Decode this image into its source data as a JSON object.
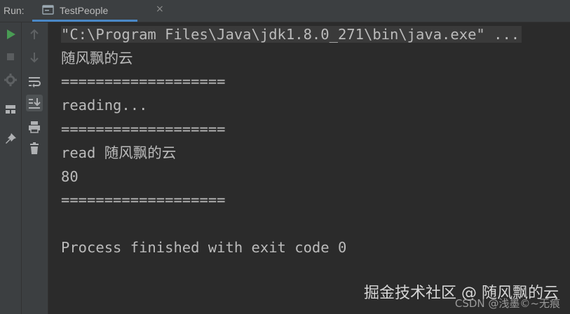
{
  "topbar": {
    "run_label": "Run:",
    "tab_label": "TestPeople",
    "tab_close": "×"
  },
  "icons": {
    "tab": "run-config-icon",
    "rerun": "run-icon",
    "stop": "stop-icon",
    "restore_layout": "restore-layout-icon",
    "layout": "layout-icon",
    "pin": "pin-icon",
    "up": "up-arrow-icon",
    "down": "down-arrow-icon",
    "soft_wrap": "soft-wrap-icon",
    "scroll_end": "scroll-to-end-icon",
    "print": "print-icon",
    "trash": "trash-icon"
  },
  "colors": {
    "run_green": "#499c54",
    "accent_blue": "#4a88c7",
    "console_bg": "#2b2b2b",
    "toolbar_bg": "#3c3f41",
    "text": "#bbbbbb"
  },
  "console": {
    "lines": [
      "\"C:\\Program Files\\Java\\jdk1.8.0_271\\bin\\java.exe\" ...",
      "随风飘的云",
      "===================",
      "reading...",
      "===================",
      "read 随风飘的云",
      "80",
      "===================",
      "",
      "Process finished with exit code 0"
    ]
  },
  "watermark": {
    "main": "掘金技术社区 @ 随风飘的云",
    "sub": "CSDN @浅墨©~无痕"
  }
}
